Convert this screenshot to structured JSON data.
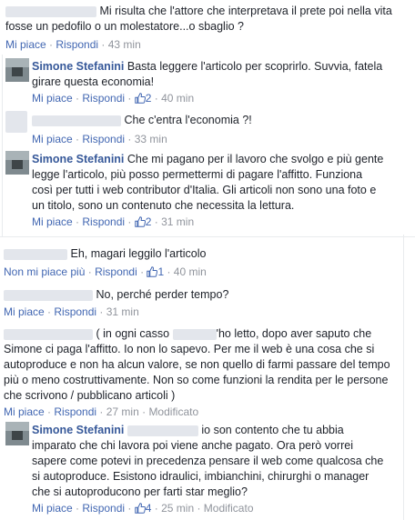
{
  "c1": {
    "text1": "Mi risulta che l'attore che interpretava il prete poi nella vita",
    "text2": "fosse un pedofilo o un molestatore...o sbaglio ?",
    "like": "Mi piace",
    "reply": "Rispondi",
    "time": "43 min"
  },
  "c2": {
    "author": "Simone Stefanini",
    "text1": "Basta leggere l'articolo per scoprirlo. Suvvia, fatela",
    "text2": "girare questa economia!",
    "like": "Mi piace",
    "reply": "Rispondi",
    "likes": "2",
    "time": "40 min"
  },
  "c3": {
    "text1": "Che c'entra l'economia ?!",
    "like": "Mi piace",
    "reply": "Rispondi",
    "time": "33 min"
  },
  "c4": {
    "author": "Simone Stefanini",
    "text1": "Che mi pagano per il lavoro che svolgo e più gente",
    "text2": "legge l'articolo, più posso permettermi di pagare l'affitto. Funziona",
    "text3": "così per tutti i web contributor d'Italia. Gli articoli non sono una foto e",
    "text4": "un titolo, sono un contenuto che necessita la lettura.",
    "like": "Mi piace",
    "reply": "Rispondi",
    "likes": "2",
    "time": "31 min"
  },
  "c5": {
    "text1": "Eh, magari leggilo l'articolo",
    "like": "Non mi piace più",
    "reply": "Rispondi",
    "likes": "1",
    "time": "40 min"
  },
  "c6": {
    "text1": "No, perché perder tempo?",
    "like": "Mi piace",
    "reply": "Rispondi",
    "time": "31 min"
  },
  "c7": {
    "text1a": "( in ogni casso",
    "text1b": "'ho letto, dopo aver saputo che",
    "text2": "Simone ci paga l'affitto. Io non lo sapevo. Per me il web è una cosa che si",
    "text3": "autoproduce e non ha alcun valore, se non quello di farmi passare del tempo",
    "text4": "più o meno costruttivamente. Non so come funzioni la rendita per le persone",
    "text5": "che scrivono / pubblicano articoli )",
    "like": "Mi piace",
    "reply": "Rispondi",
    "time": "27 min",
    "edited": "Modificato"
  },
  "c8": {
    "author": "Simone Stefanini",
    "text1": "io son contento che tu abbia",
    "text2": "imparato che chi lavora poi viene anche pagato. Ora però vorrei",
    "text3": "sapere come potevi in precedenza pensare il web come qualcosa che",
    "text4": "si autoproduce. Esistono idraulici, imbianchini, chirurghi o manager",
    "text5": "che si autoproducono per farti star meglio?",
    "like": "Mi piace",
    "reply": "Rispondi",
    "likes": "4",
    "time": "25 min",
    "edited": "Modificato"
  },
  "colors": {
    "link": "#4267b2",
    "name": "#365899",
    "meta": "#90949c",
    "text": "#1d2129"
  },
  "icons": {
    "like": "thumbs-up-icon"
  }
}
